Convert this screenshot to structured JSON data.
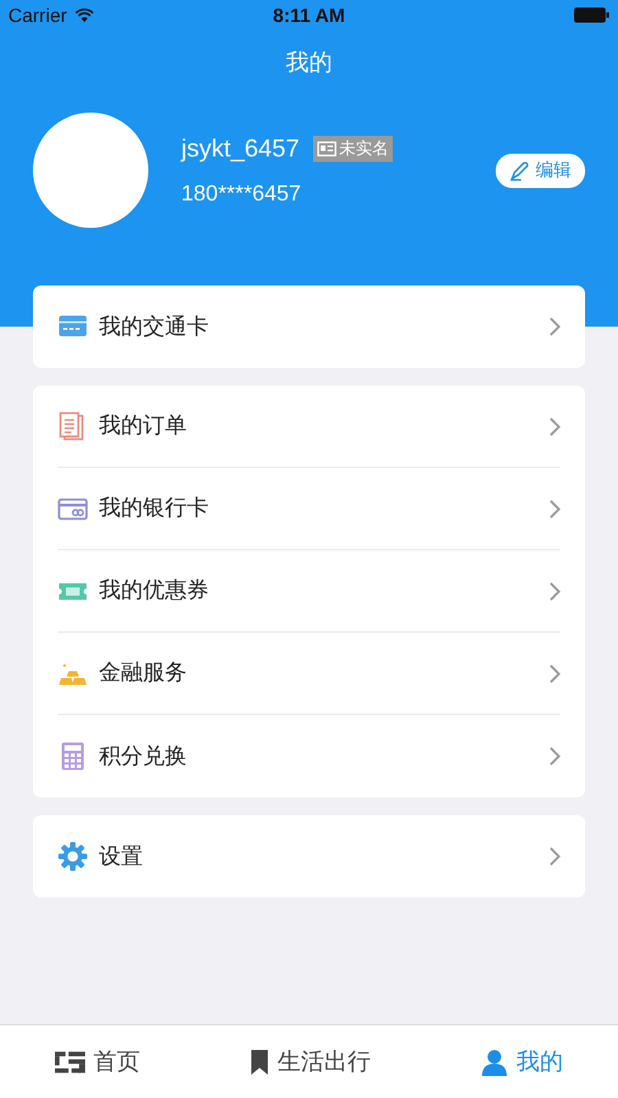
{
  "status_bar": {
    "carrier": "Carrier",
    "time": "8:11 AM"
  },
  "nav": {
    "title": "我的"
  },
  "profile": {
    "username": "jsykt_6457",
    "badge": "未实名",
    "phone": "180****6457",
    "edit": "编辑"
  },
  "groups": [
    {
      "items": [
        {
          "kind": "card",
          "label": "我的交通卡"
        }
      ]
    },
    {
      "items": [
        {
          "kind": "order",
          "label": "我的订单"
        },
        {
          "kind": "bankcard",
          "label": "我的银行卡"
        },
        {
          "kind": "coupon",
          "label": "我的优惠券"
        },
        {
          "kind": "gold",
          "label": "金融服务"
        },
        {
          "kind": "calculator",
          "label": "积分兑换"
        }
      ]
    },
    {
      "items": [
        {
          "kind": "gear",
          "label": "设置"
        }
      ]
    }
  ],
  "tabs": [
    {
      "kind": "home",
      "label": "首页",
      "selected": false
    },
    {
      "kind": "bookmark",
      "label": "生活出行",
      "selected": false
    },
    {
      "kind": "person",
      "label": "我的",
      "selected": true
    }
  ]
}
